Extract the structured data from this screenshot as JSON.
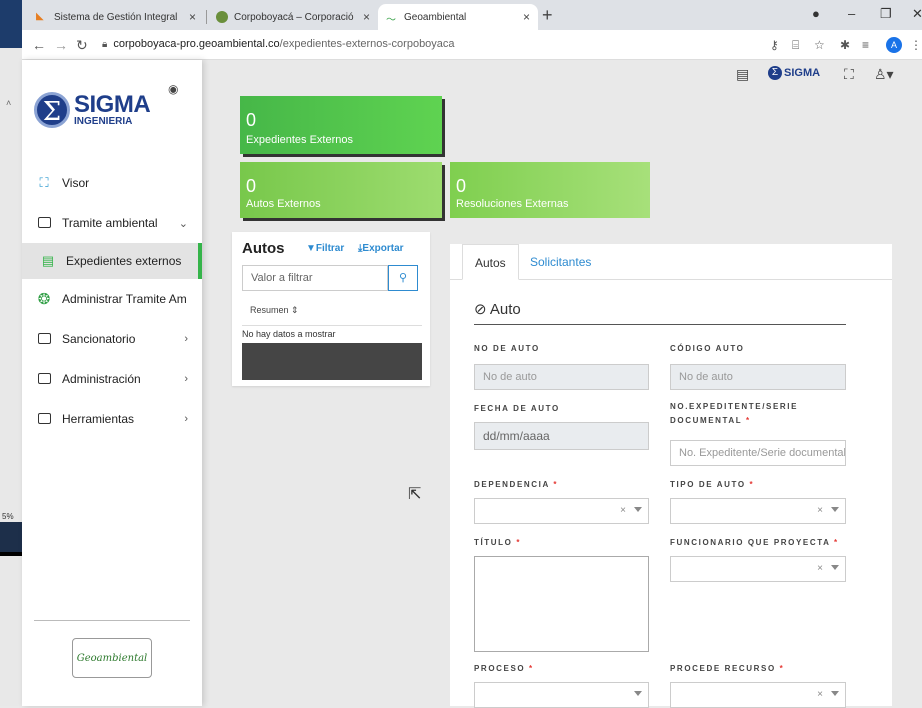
{
  "desktop": {
    "side_label": "5%"
  },
  "browser": {
    "tabs": [
      {
        "label": "Sistema de Gestión Integral",
        "close": "×"
      },
      {
        "label": "Corpoboyacá – Corporación Autó",
        "close": "×"
      },
      {
        "label": "Geoambiental",
        "close": "×"
      }
    ],
    "new_tab": "+",
    "url_domain": "corpoboyaca-pro.geoambiental.co",
    "url_path": "/expedientes-externos-corpoboyaca",
    "profile_initial": "A"
  },
  "sidebar": {
    "logo_main": "SIGMA",
    "logo_sub": "INGENIERIA",
    "items": [
      {
        "label": "Visor"
      },
      {
        "label": "Tramite ambiental"
      },
      {
        "label": "Expedientes externos"
      },
      {
        "label": "Administrar Tramite Am"
      },
      {
        "label": "Sancionatorio"
      },
      {
        "label": "Administración"
      },
      {
        "label": "Herramientas"
      }
    ],
    "footer_logo": "Geoambiental"
  },
  "header": {
    "sigma_label": "SIGMA"
  },
  "stats": [
    {
      "value": "0",
      "label": "Expedientes Externos"
    },
    {
      "value": "0",
      "label": "Autos Externos"
    },
    {
      "value": "0",
      "label": "Resoluciones Externas"
    }
  ],
  "autos_panel": {
    "title": "Autos",
    "filter_label": "Filtrar",
    "export_label": "Exportar",
    "search_placeholder": "Valor a filtrar",
    "column_header": "Resumen",
    "empty_text": "No hay datos a mostrar"
  },
  "form": {
    "tabs": [
      "Autos",
      "Solicitantes"
    ],
    "section_title": "Auto",
    "fields": {
      "no_auto_label": "NO DE AUTO",
      "no_auto_placeholder": "No de auto",
      "codigo_label": "CÓDIGO AUTO",
      "codigo_placeholder": "No de auto",
      "fecha_label": "FECHA DE AUTO",
      "fecha_placeholder": "dd/mm/aaaa",
      "expediente_label": "NO.EXPEDITENTE/SERIE DOCUMENTAL",
      "expediente_placeholder": "No. Expeditente/Serie documental",
      "dependencia_label": "DEPENDENCIA",
      "tipo_label": "TIPO DE AUTO",
      "titulo_label": "TÍTULO",
      "funcionario_label": "FUNCIONARIO QUE PROYECTA",
      "proceso_label": "PROCESO",
      "recurso_label": "PROCEDE RECURSO",
      "required_mark": "*"
    }
  }
}
